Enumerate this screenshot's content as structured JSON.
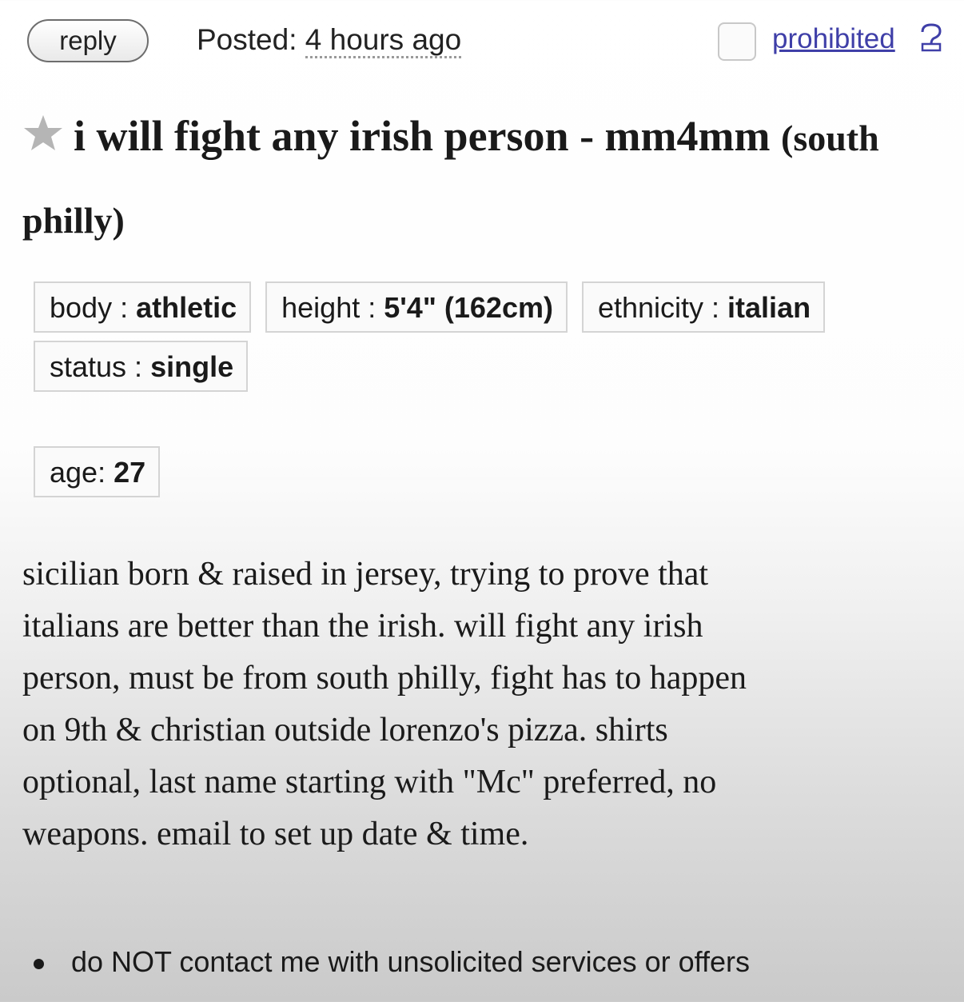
{
  "header": {
    "reply_label": "reply",
    "posted_prefix": "Posted: ",
    "posted_time": "4 hours ago",
    "prohibited_label": "prohibited",
    "help_icon": "question-mark-icon"
  },
  "post": {
    "title_icon": "star-icon",
    "title": "i will fight any irish person - mm4mm",
    "location": "(south philly)",
    "attributes": {
      "body": {
        "label": "body : ",
        "value": "athletic"
      },
      "height": {
        "label": "height : ",
        "value": "5'4\" (162cm)"
      },
      "ethnicity": {
        "label": "ethnicity : ",
        "value": "italian"
      },
      "status": {
        "label": "status : ",
        "value": "single"
      },
      "age": {
        "label": "age: ",
        "value": "27"
      }
    },
    "body_lines": [
      "sicilian born & raised in jersey, trying to prove that",
      "italians are better than the irish. will fight any irish",
      "person, must be from south philly, fight has to happen",
      "on 9th & christian outside lorenzo's pizza. shirts",
      "optional, last name starting with \"Mc\" preferred, no",
      "weapons. email to set up date & time."
    ],
    "notices": [
      "do NOT contact me with unsolicited services or offers"
    ]
  },
  "colors": {
    "link": "#3f3fa8",
    "text": "#1a1a1a",
    "border": "#d4d4d4"
  }
}
